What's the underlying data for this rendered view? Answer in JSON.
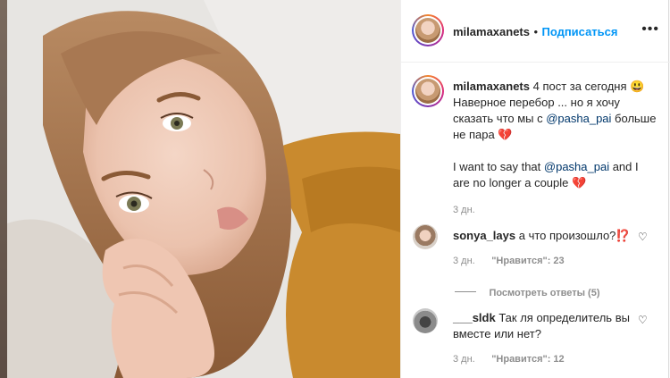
{
  "post": {
    "author": "milamaxanets",
    "dot": "•",
    "follow_label": "Подписаться",
    "more_icon": "more-horizontal-icon"
  },
  "caption": {
    "author": "milamaxanets",
    "line1_after": " 4 пост за сегодня 😃",
    "line2": "Наверное перебор ... но я хочу",
    "line3_before": "сказать что мы с ",
    "mention1": "@pasha_pai",
    "line3_after": " больше",
    "line4": "не пара 💔",
    "line5_before": "I want to say that ",
    "mention2": "@pasha_pai",
    "line5_after": " and I",
    "line6": "are no longer a couple 💔",
    "time": "3 дн."
  },
  "comments": [
    {
      "author": "sonya_lays",
      "text": " а что произошло?⁉️",
      "time": "3 дн.",
      "likes": "\"Нравится\": 23",
      "view_replies": "Посмотреть ответы (5)"
    },
    {
      "author": "___sldk",
      "text_line1": " Так ля определитель вы",
      "text_line2": "вместе или нет?",
      "time": "3 дн.",
      "likes": "\"Нравится\": 12"
    }
  ],
  "colors": {
    "follow": "#0095f6",
    "mention": "#00376b",
    "meta": "#8e8e8e"
  }
}
